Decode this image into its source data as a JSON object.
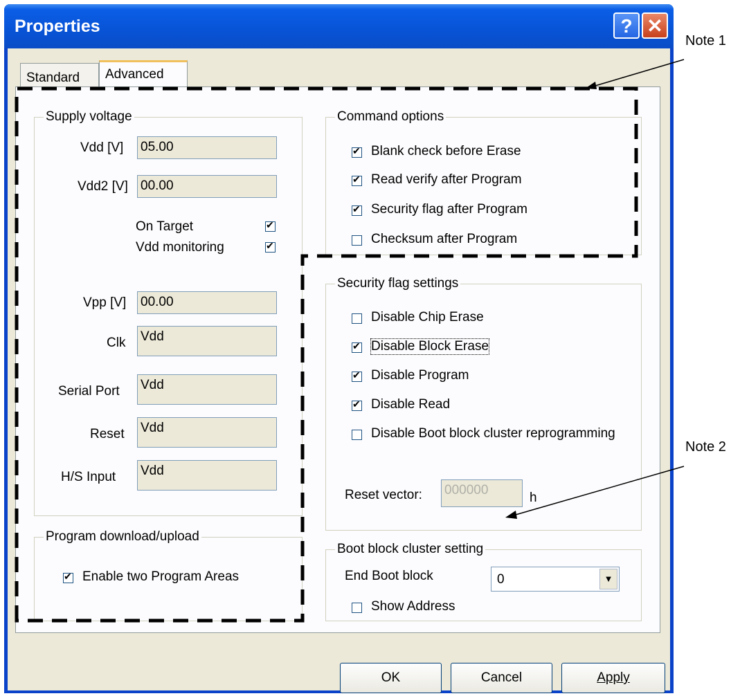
{
  "window": {
    "title": "Properties",
    "help_label": "?",
    "close_label": "✕"
  },
  "tabs": [
    {
      "label": "Standard"
    },
    {
      "label": "Advanced"
    }
  ],
  "supply_voltage": {
    "legend": "Supply voltage",
    "vdd_label": "Vdd [V]",
    "vdd_value": "05.00",
    "vdd2_label": "Vdd2 [V]",
    "vdd2_value": "00.00",
    "on_target_label": "On Target",
    "on_target_checked": true,
    "vdd_monitoring_label": "Vdd monitoring",
    "vdd_monitoring_checked": true,
    "vpp_label": "Vpp [V]",
    "vpp_value": "00.00",
    "clk_label": "Clk",
    "clk_value": "Vdd",
    "serial_port_label": "Serial Port",
    "serial_port_value": "Vdd",
    "reset_label": "Reset",
    "reset_value": "Vdd",
    "hs_input_label": "H/S Input",
    "hs_input_value": "Vdd"
  },
  "program_download": {
    "legend": "Program download/upload",
    "enable_two_label": "Enable two Program Areas",
    "enable_two_checked": true
  },
  "command_options": {
    "legend": "Command options",
    "items": [
      {
        "label": "Blank check before Erase",
        "checked": true
      },
      {
        "label": "Read verify after Program",
        "checked": true
      },
      {
        "label": "Security flag after Program",
        "checked": true
      },
      {
        "label": "Checksum after Program",
        "checked": false
      }
    ]
  },
  "security_flags": {
    "legend": "Security flag settings",
    "items": [
      {
        "label": "Disable Chip Erase",
        "checked": false
      },
      {
        "label": "Disable Block Erase",
        "checked": true
      },
      {
        "label": "Disable Program",
        "checked": true
      },
      {
        "label": "Disable Read",
        "checked": true
      },
      {
        "label": "Disable Boot block cluster reprogramming",
        "checked": false
      }
    ],
    "reset_vector_label": "Reset vector:",
    "reset_vector_value": "000000",
    "reset_vector_unit": "h"
  },
  "boot_block": {
    "legend": "Boot block cluster setting",
    "end_label": "End Boot block",
    "end_value": "0",
    "show_address_label": "Show Address",
    "show_address_checked": false
  },
  "buttons": {
    "ok": "OK",
    "cancel": "Cancel",
    "apply": "Apply"
  },
  "notes": {
    "note1": "Note 1",
    "note2": "Note 2"
  }
}
